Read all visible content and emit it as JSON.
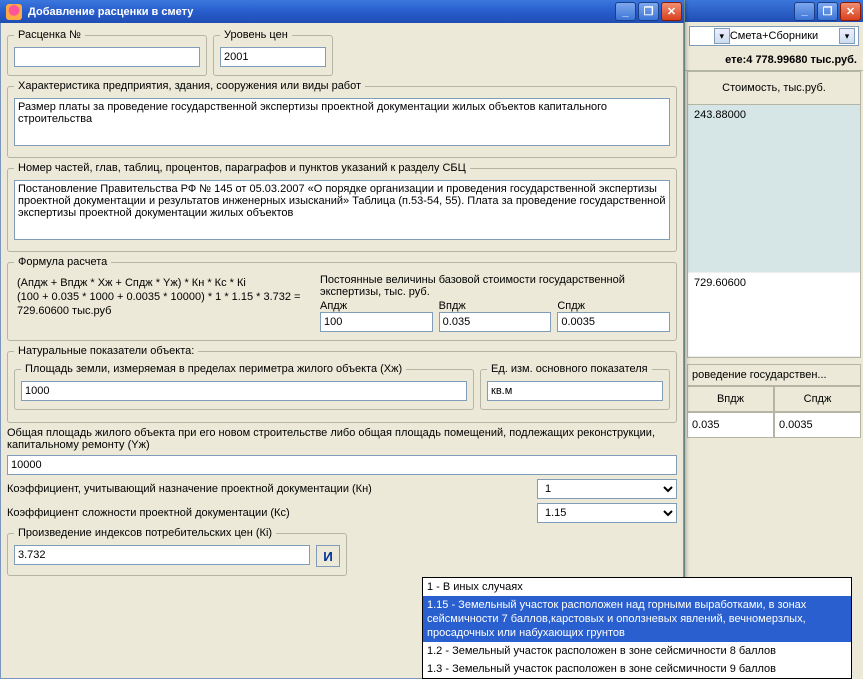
{
  "window": {
    "title": "Добавление расценки в смету"
  },
  "topRow": {
    "rateLegend": "Расценка №",
    "rateValue": "",
    "priceLegend": "Уровень цен",
    "priceValue": "2001"
  },
  "charLegend": "Характеристика предприятия, здания, сооружения или виды работ",
  "charText": "Размер платы за проведение государственной экспертизы проектной документации жилых объектов капитального строительства",
  "sbcLegend": "Номер частей, глав, таблиц, процентов, параграфов и пунктов указаний к разделу СБЦ",
  "sbcText": "Постановление Правительства РФ № 145 от 05.03.2007 «О порядке организации и проведения государственной экспертизы проектной документации и результатов инженерных изысканий» Таблица (п.53-54, 55). Плата за проведение государственной экспертизы проектной документации жилых объектов",
  "formulaLegend": "Формула расчета",
  "formulaText": "(Апдж + Впдж * Хж + Спдж * Yж) * Кн * Кс * Кi\n(100 + 0.035 * 1000 + 0.0035 * 10000) * 1 * 1.15 * 3.732 = 729.60600 тыс.руб",
  "constLabel": "Постоянные величины базовой стоимости государственной экспертизы, тыс. руб.",
  "const": {
    "aLabel": "Апдж",
    "a": "100",
    "bLabel": "Впдж",
    "b": "0.035",
    "cLabel": "Спдж",
    "c": "0.0035"
  },
  "natLegend": "Натуральные показатели объекта:",
  "areaLegend": "Площадь земли, измеряемая в пределах периметра жилого объекта (Хж)",
  "areaValue": "1000",
  "unitLegend": "Ед. изм. основного показателя",
  "unitValue": "кв.м",
  "totalAreaLabel": "Общая площадь жилого объекта при его новом строительстве либо общая площадь помещений, подлежащих реконструкции, капитальному ремонту (Yж)",
  "totalAreaValue": "10000",
  "knLabel": "Коэффициент, учитывающий назначение проектной документации (Кн)",
  "knValue": "1",
  "ksLabel": "Коэффициент сложности проектной документации (Кс)",
  "ksValue": "1.15",
  "kiLegend": "Произведение индексов потребительских цен (Кi)",
  "kiValue": "3.732",
  "kiBtn": "И",
  "dropdown": {
    "opt1": "1 - В иных случаях",
    "opt2": "1.15 - Земельный участок расположен над горными выработками, в зонах сейсмичности 7 баллов,карстовых и оползневых явлений, вечномерзлых, просадочных или набухающих грунтов",
    "opt3": "1.2 - Земельный участок расположен в зоне сейсмичности 8 баллов",
    "opt4": "1.3 - Земельный участок расположен в зоне сейсмичности 9 баллов"
  },
  "right": {
    "combo": "Смета+Сборники",
    "totalLabelPrefix": "ете:",
    "totalValue": "4 778.99680 тыс.руб.",
    "costHeader": "Стоимость, тыс.руб.",
    "row1": "243.88000",
    "row2": "729.60600",
    "sub": "роведение государствен...",
    "col1": "Впдж",
    "col2": "Спдж",
    "val1": "0.035",
    "val2": "0.0035"
  }
}
